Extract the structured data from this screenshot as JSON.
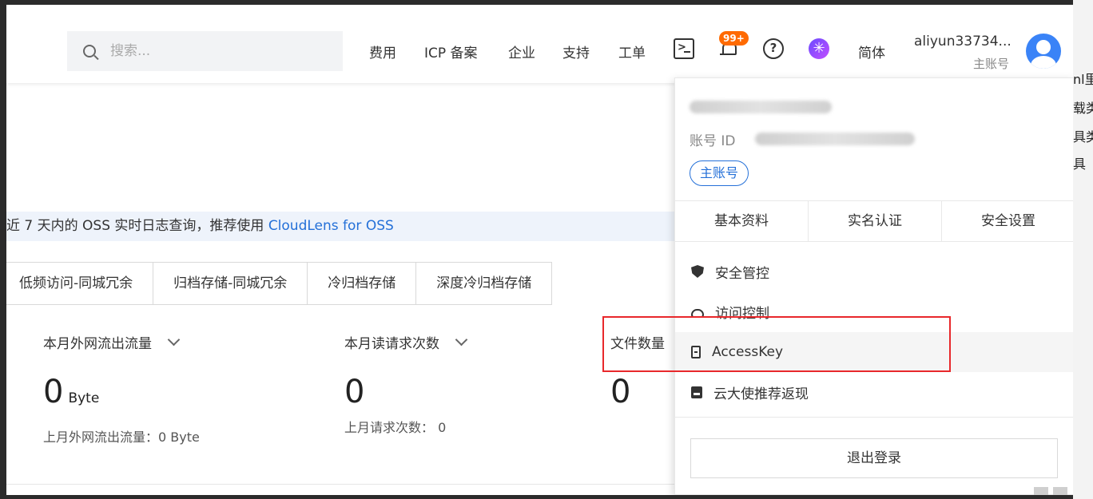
{
  "header": {
    "search_placeholder": "搜索...",
    "nav": [
      "费用",
      "ICP 备案",
      "企业",
      "支持",
      "工单"
    ],
    "notification_badge": "99+",
    "help_glyph": "?",
    "language": "简体",
    "user_name": "aliyun33734...",
    "user_role": "主账号"
  },
  "notice": {
    "text": "近 7 天内的 OSS 实时日志查询，推荐使用 ",
    "link": "CloudLens for OSS"
  },
  "storage_tabs": [
    "低频访问-同城冗余",
    "归档存储-同城冗余",
    "冷归档存储",
    "深度冷归档存储"
  ],
  "metrics": {
    "outbound": {
      "title": "本月外网流出流量",
      "value": "0",
      "unit": "Byte",
      "sub": "上月外网流出流量：0 Byte"
    },
    "reads": {
      "title": "本月读请求次数",
      "value": "0",
      "sub": "上月请求次数：  0"
    },
    "files": {
      "title": "文件数量",
      "value": "0"
    }
  },
  "dropdown": {
    "account_id_label": "账号 ID",
    "role_pill": "主账号",
    "quick_tabs": [
      "基本资料",
      "实名认证",
      "安全设置"
    ],
    "menu": [
      {
        "label": "安全管控",
        "icon": "shield-icon"
      },
      {
        "label": "访问控制",
        "icon": "cloud-icon"
      },
      {
        "label": "AccessKey",
        "icon": "key-icon"
      },
      {
        "label": "云大使推荐返现",
        "icon": "card-icon"
      }
    ],
    "logout": "退出登录"
  },
  "background_text": [
    "nl里",
    "载类",
    "具类",
    "具"
  ],
  "colors": {
    "accent": "#2470d8",
    "badge": "#ff6a00",
    "highlight_box": "#e8282b"
  }
}
